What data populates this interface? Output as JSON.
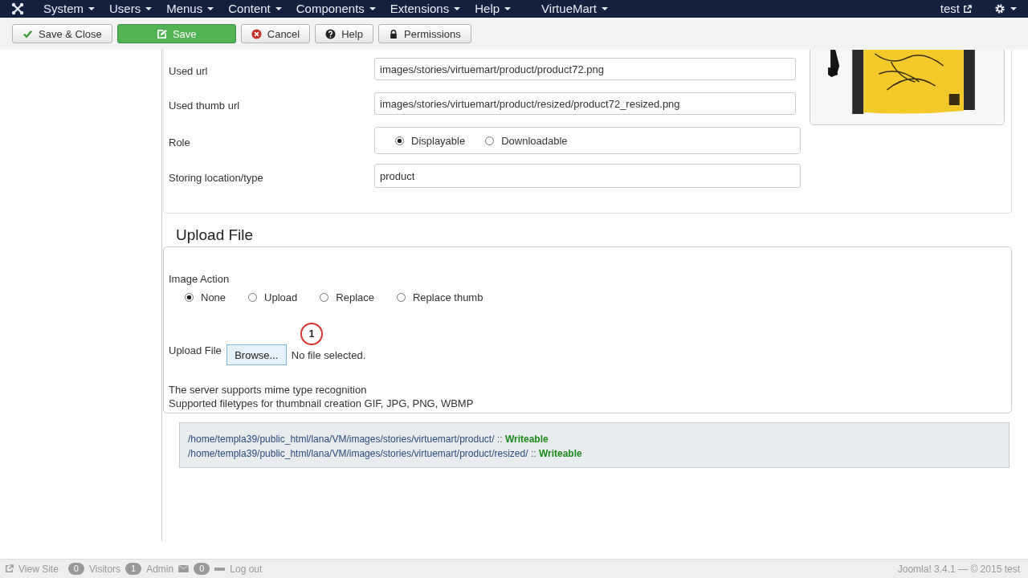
{
  "navbar": {
    "menus": [
      "System",
      "Users",
      "Menus",
      "Content",
      "Components",
      "Extensions",
      "Help",
      "VirtueMart"
    ],
    "user": "test"
  },
  "toolbar": [
    {
      "label": "Save & Close",
      "kind": "check",
      "primary": false
    },
    {
      "label": "Save",
      "kind": "edit",
      "primary": true
    },
    {
      "label": "Cancel",
      "kind": "cancel",
      "primary": false
    },
    {
      "label": "Help",
      "kind": "help",
      "primary": false
    },
    {
      "label": "Permissions",
      "kind": "lock",
      "primary": false
    }
  ],
  "media": {
    "fields": [
      {
        "kind": "text",
        "label": "Used url",
        "value": "images/stories/virtuemart/product/product72.png"
      },
      {
        "kind": "text",
        "label": "Used thumb url",
        "value": "images/stories/virtuemart/product/resized/product72_resized.png"
      },
      {
        "kind": "radio",
        "label": "Role",
        "options": [
          {
            "label": "Displayable",
            "selected": true
          },
          {
            "label": "Downloadable",
            "selected": false
          }
        ]
      },
      {
        "kind": "text",
        "label": "Storing location/type",
        "value": "product"
      }
    ]
  },
  "upload": {
    "legend": "Upload File",
    "action_label": "Image Action",
    "actions": [
      {
        "label": "None",
        "selected": true
      },
      {
        "label": "Upload",
        "selected": false
      },
      {
        "label": "Replace",
        "selected": false
      },
      {
        "label": "Replace thumb",
        "selected": false
      }
    ],
    "file_label": "Upload File",
    "browse": "Browse...",
    "file_status": "No file selected.",
    "callout": "1",
    "notes": [
      "The server supports mime type recognition",
      "Supported filetypes for thumbnail creation GIF, JPG, PNG, WBMP"
    ]
  },
  "paths": [
    {
      "path": "/home/templa39/public_html/lana/VM/images/stories/virtuemart/product/",
      "sep": "::",
      "status": "Writeable"
    },
    {
      "path": "/home/templa39/public_html/lana/VM/images/stories/virtuemart/product/resized/",
      "sep": "::",
      "status": "Writeable"
    }
  ],
  "status_bar": {
    "view_site": "View Site",
    "visitors_count": "0",
    "visitors": "Visitors",
    "admin_count": "1",
    "admin": "Admin",
    "messages_count": "0",
    "logout": "Log out",
    "version": "Joomla! 3.4.1 — © 2015 test"
  }
}
